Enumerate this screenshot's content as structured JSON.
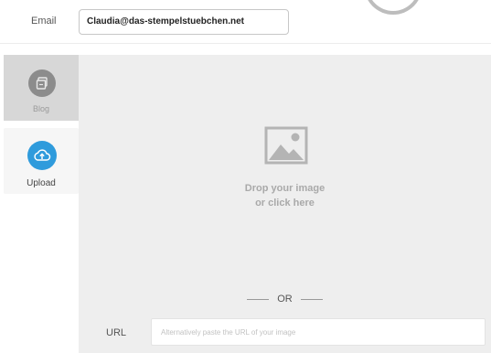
{
  "email": {
    "label": "Email",
    "value": "Claudia@das-stempelstuebchen.net"
  },
  "sidebar": {
    "items": [
      {
        "label": "Blog",
        "icon": "blog-icon",
        "active": false
      },
      {
        "label": "Upload",
        "icon": "upload-cloud-icon",
        "active": true
      }
    ]
  },
  "dropzone": {
    "icon": "image-icon",
    "line1": "Drop your image",
    "line2": "or click here"
  },
  "divider": {
    "label": "OR"
  },
  "url": {
    "label": "URL",
    "placeholder": "Alternatively paste the URL of your image"
  },
  "colors": {
    "accent": "#2f9bdc",
    "sidebar_active_bg": "#d7d7d7",
    "dropzone_bg": "#eeeeee"
  }
}
